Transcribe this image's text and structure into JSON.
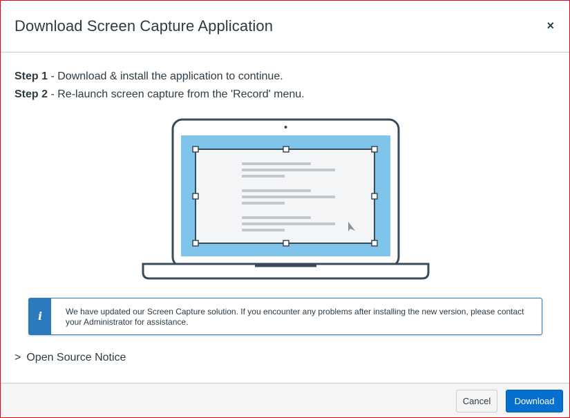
{
  "modal": {
    "title": "Download Screen Capture Application",
    "close_label": "×"
  },
  "steps": [
    {
      "label": "Step 1",
      "text": " - Download & install the application to continue."
    },
    {
      "label": "Step 2",
      "text": " - Re-launch screen capture from the 'Record' menu."
    }
  ],
  "illustration": {
    "icon": "laptop-screen-capture-illustration",
    "screen_color": "#7fc4ea",
    "frame_color": "#394b58"
  },
  "info": {
    "icon": "info-icon",
    "icon_glyph": "i",
    "text": "We have updated our Screen Capture solution. If you encounter any problems after installing the new version, please contact your Administrator for assistance.",
    "accent": "#2b7abc"
  },
  "open_source": {
    "chevron_icon": "chevron-right-icon",
    "chevron_glyph": ">",
    "label": "Open Source Notice"
  },
  "footer": {
    "cancel_label": "Cancel",
    "download_label": "Download",
    "download_color": "#0770cf"
  }
}
